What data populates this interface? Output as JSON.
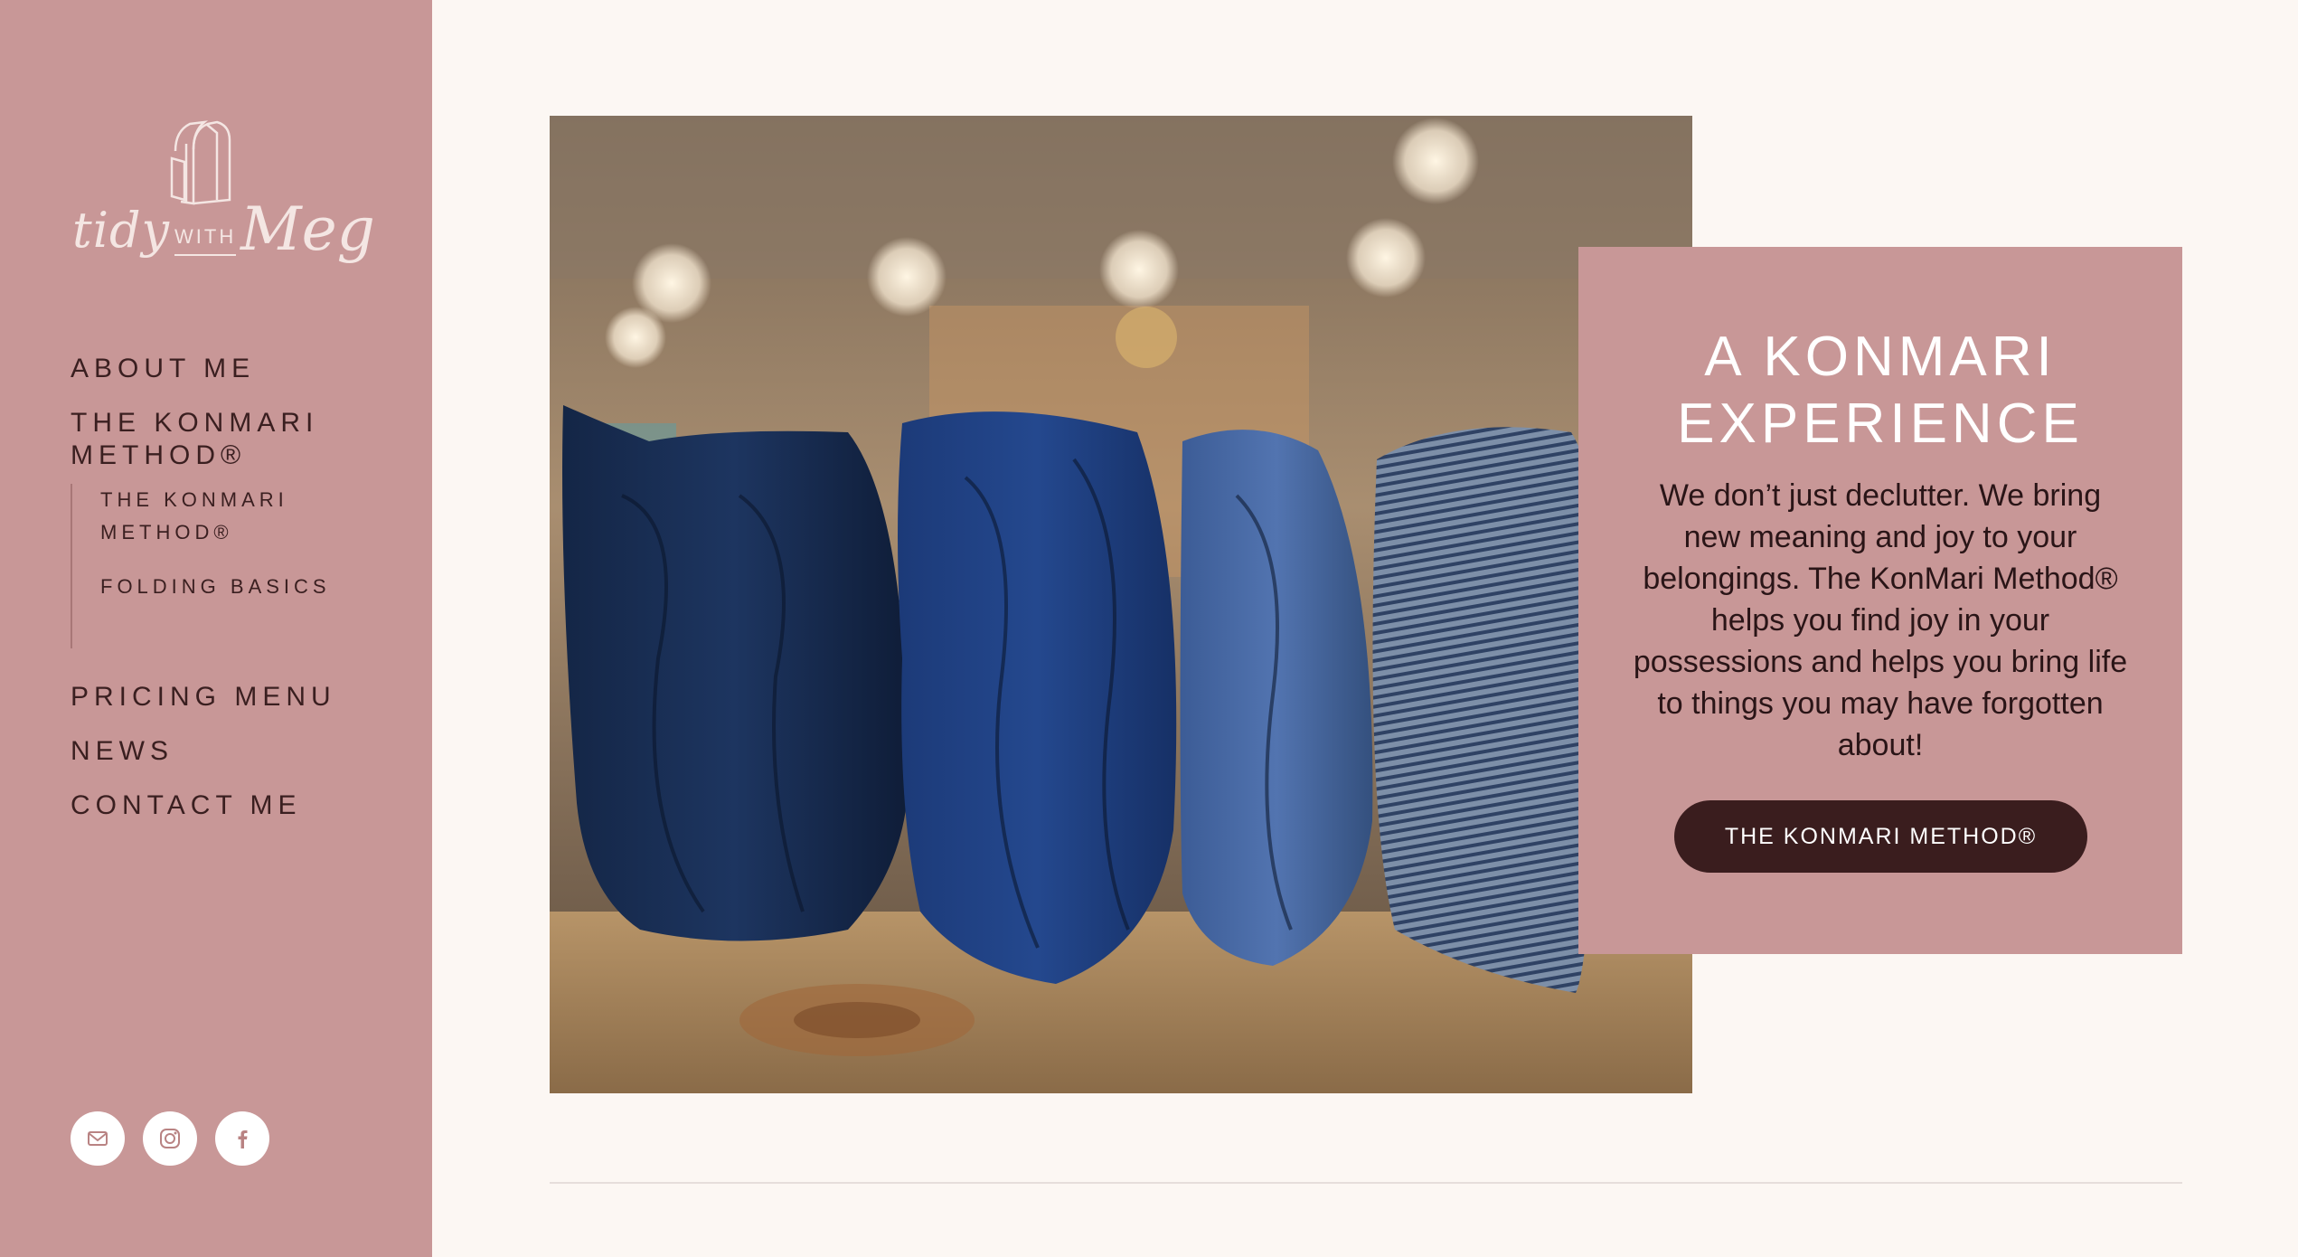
{
  "brand": {
    "logo_tidy": "tidy",
    "logo_with": "WITH",
    "logo_name": "Meg"
  },
  "nav": {
    "items": [
      {
        "label": "ABOUT ME"
      },
      {
        "label": "THE KONMARI METHOD®"
      },
      {
        "label": "PRICING MENU"
      },
      {
        "label": "NEWS"
      },
      {
        "label": "CONTACT ME"
      }
    ],
    "subitems": [
      {
        "label": "THE KONMARI METHOD®"
      },
      {
        "label": "FOLDING BASICS"
      }
    ]
  },
  "social": [
    {
      "icon": "mail-icon"
    },
    {
      "icon": "instagram-icon"
    },
    {
      "icon": "facebook-icon"
    }
  ],
  "hero": {
    "image": "folded-jeans-photo"
  },
  "card": {
    "title": "A KONMARI EXPERIENCE",
    "body": "We don’t just declutter. We bring new meaning and joy to your belongings. The KonMari Method® helps you find joy in your possessions and helps you bring life to things you may have forgotten about!",
    "button_label": "THE KONMARI METHOD®"
  },
  "colors": {
    "sidebar": "#c89797",
    "page_background": "#fcf7f3",
    "text_dark": "#3a1f20",
    "button": "#3a1d1e"
  }
}
